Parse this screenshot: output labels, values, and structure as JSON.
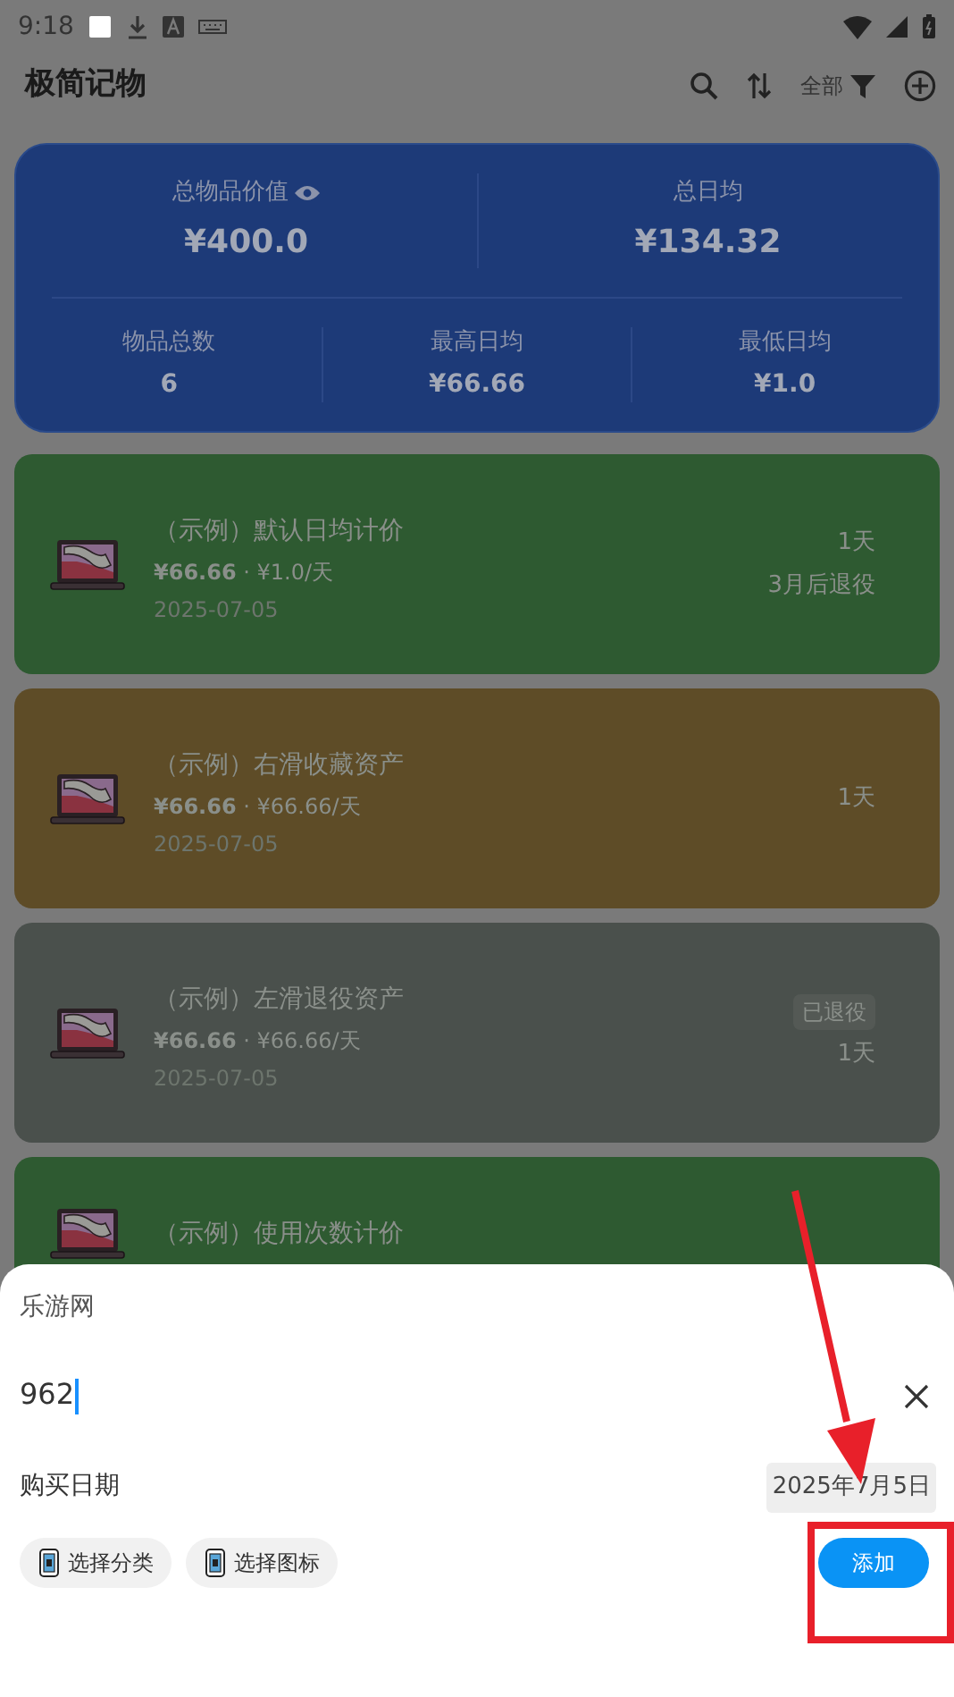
{
  "status_bar": {
    "time": "9:18"
  },
  "app_bar": {
    "title": "极简记物",
    "filter_label": "全部"
  },
  "summary": {
    "total_value_label": "总物品价值",
    "total_value": "¥400.0",
    "daily_label": "总日均",
    "daily": "¥134.32",
    "stats": [
      {
        "label": "物品总数",
        "value": "6"
      },
      {
        "label": "最高日均",
        "value": "¥66.66"
      },
      {
        "label": "最低日均",
        "value": "¥1.0"
      }
    ]
  },
  "items": [
    {
      "title": "（示例）默认日均计价",
      "price_line": "**¥66.66** · ¥1.0/天",
      "date": "2025-07-05",
      "days": "1天",
      "note": "3月后退役",
      "color": "#2e5a31"
    },
    {
      "title": "（示例）右滑收藏资产",
      "price_line": "**¥66.66** · ¥66.66/天",
      "date": "2025-07-05",
      "days": "1天",
      "color": "#5e4c27"
    },
    {
      "title": "（示例）左滑退役资产",
      "price_line": "**¥66.66** · ¥66.66/天",
      "date": "2025-07-05",
      "badge": "已退役",
      "days": "1天",
      "color": "#4a504c"
    },
    {
      "title": "（示例）使用次数计价",
      "color": "#2e5a31"
    }
  ],
  "sheet": {
    "name_field": {
      "value": "乐游网"
    },
    "price_field": {
      "value": "962"
    },
    "date_label": "购买日期",
    "date": "2025年7月5日",
    "chips": [
      {
        "label": "选择分类"
      },
      {
        "label": "选择图标"
      }
    ],
    "submit": "添加"
  },
  "annotation_arrow": true,
  "highlight_frame": true
}
